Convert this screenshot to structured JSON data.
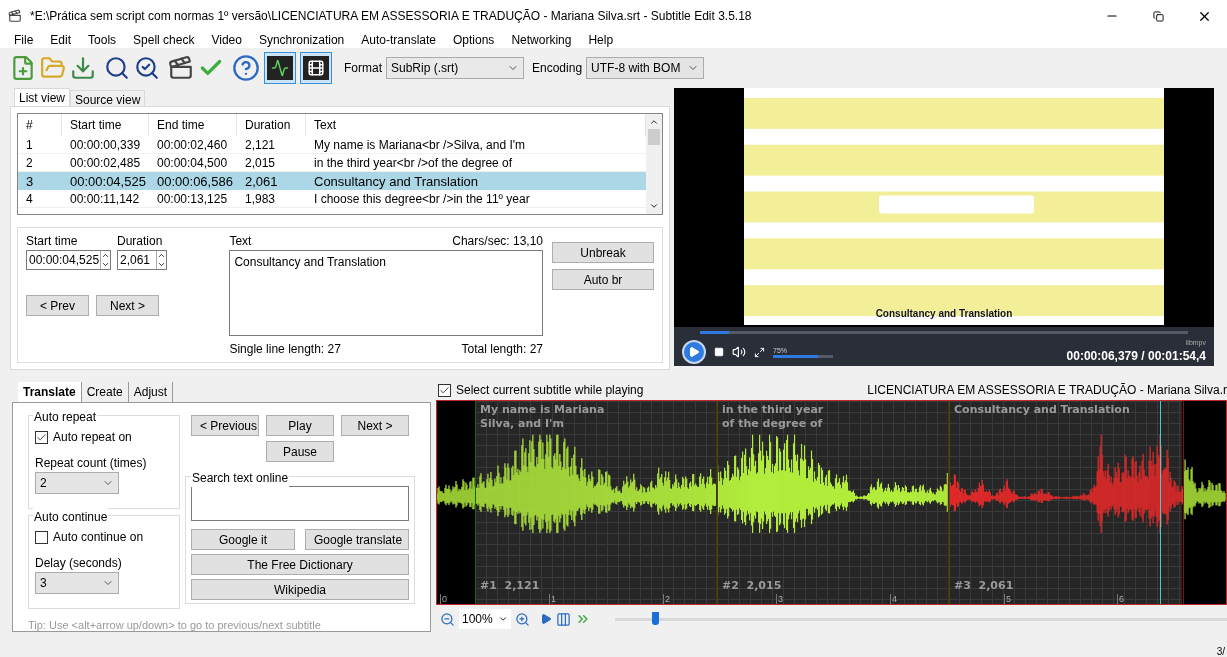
{
  "window": {
    "title": "*E:\\Prática sem script com normas 1º versão\\LICENCIATURA EM ASSESSORIA E TRADUÇÃO - Mariana Silva.srt - Subtitle Edit 3.5.18"
  },
  "menu": [
    "File",
    "Edit",
    "Tools",
    "Spell check",
    "Video",
    "Synchronization",
    "Auto-translate",
    "Options",
    "Networking",
    "Help"
  ],
  "toolbar": {
    "toggles": [
      {
        "kind": "waveform",
        "selected": true
      },
      {
        "kind": "video",
        "selected": true
      }
    ],
    "format_label": "Format",
    "format": "SubRip (.srt)",
    "encoding_label": "Encoding",
    "encoding": "UTF-8 with BOM"
  },
  "list_tabs": [
    {
      "label": "List view",
      "selected": true
    },
    {
      "label": "Source view",
      "selected": false
    }
  ],
  "table": {
    "columns": [
      "#",
      "Start time",
      "End time",
      "Duration",
      "Text"
    ],
    "rows": [
      {
        "cells": [
          "1",
          "00:00:00,339",
          "00:00:02,460",
          "2,121",
          "My name is Mariana<br />Silva, and I'm"
        ],
        "selected": false
      },
      {
        "cells": [
          "2",
          "00:00:02,485",
          "00:00:04,500",
          "2,015",
          "in the third year<br />of the degree of"
        ],
        "selected": false
      },
      {
        "cells": [
          "3",
          "00:00:04,525",
          "00:00:06,586",
          "2,061",
          "Consultancy and Translation"
        ],
        "selected": true
      },
      {
        "cells": [
          "4",
          "00:00:11,142",
          "00:00:13,125",
          "1,983",
          "I choose this degree<br />in the 11º year"
        ],
        "selected": false
      }
    ]
  },
  "editor": {
    "start_time_label": "Start time",
    "start_time": "00:00:04,525",
    "duration_label": "Duration",
    "duration": "2,061",
    "text_label": "Text",
    "chars_sec": "Chars/sec: 13,10",
    "text": "Consultancy and Translation",
    "single_line": "Single line length: 27",
    "total_length": "Total length: 27",
    "prev": "< Prev",
    "next": "Next >",
    "unbreak": "Unbreak",
    "auto_br": "Auto br"
  },
  "video": {
    "subtitle": "Consultancy and Translation",
    "progress": {
      "level": 0.06
    },
    "volume": {
      "reading": "75%",
      "level": 0.75
    },
    "engine": "libmpv",
    "time": "00:00:06,379 / 00:01:54,4"
  },
  "bottom_tabs": [
    {
      "label": "Translate",
      "selected": true
    },
    {
      "label": "Create",
      "selected": false
    },
    {
      "label": "Adjust",
      "selected": false
    }
  ],
  "translate": {
    "auto_repeat": {
      "title": "Auto repeat",
      "checkbox": {
        "label": "Auto repeat on",
        "checked": true
      },
      "count_label": "Repeat count (times)",
      "count": "2"
    },
    "auto_continue": {
      "title": "Auto continue",
      "checkbox": {
        "label": "Auto continue on",
        "checked": false
      },
      "delay_label": "Delay (seconds)",
      "delay": "3"
    },
    "previous": "< Previous",
    "play": "Play",
    "next": "Next >",
    "pause": "Pause",
    "search": {
      "title": "Search text online",
      "buttons": [
        "Google it",
        "Google translate",
        "The Free Dictionary",
        "Wikipedia"
      ]
    },
    "tip": "Tip: Use <alt+arrow up/down> to go to previous/next subtitle"
  },
  "waveform": {
    "select_checkbox": {
      "label": "Select current subtitle while playing",
      "checked": true
    },
    "title": "LICENCIATURA EM ASSESSORIA E TRADUÇÃO - Mariana Silva.r",
    "segments": [
      {
        "lines": [
          "My name is Mariana",
          "Silva, and I'm"
        ],
        "label": "#1  2,121",
        "selected": false
      },
      {
        "lines": [
          "in the third year",
          "of the degree of"
        ],
        "label": "#2  2,015",
        "selected": false
      },
      {
        "lines": [
          "Consultancy and Translation"
        ],
        "label": "#3  2,061",
        "selected": true
      }
    ],
    "ticks": [
      "0",
      "1",
      "2",
      "3",
      "4",
      "5",
      "6"
    ],
    "zoom": "100%",
    "slider": {
      "level": 0.06
    }
  },
  "status_bar": {
    "position": "3/"
  }
}
